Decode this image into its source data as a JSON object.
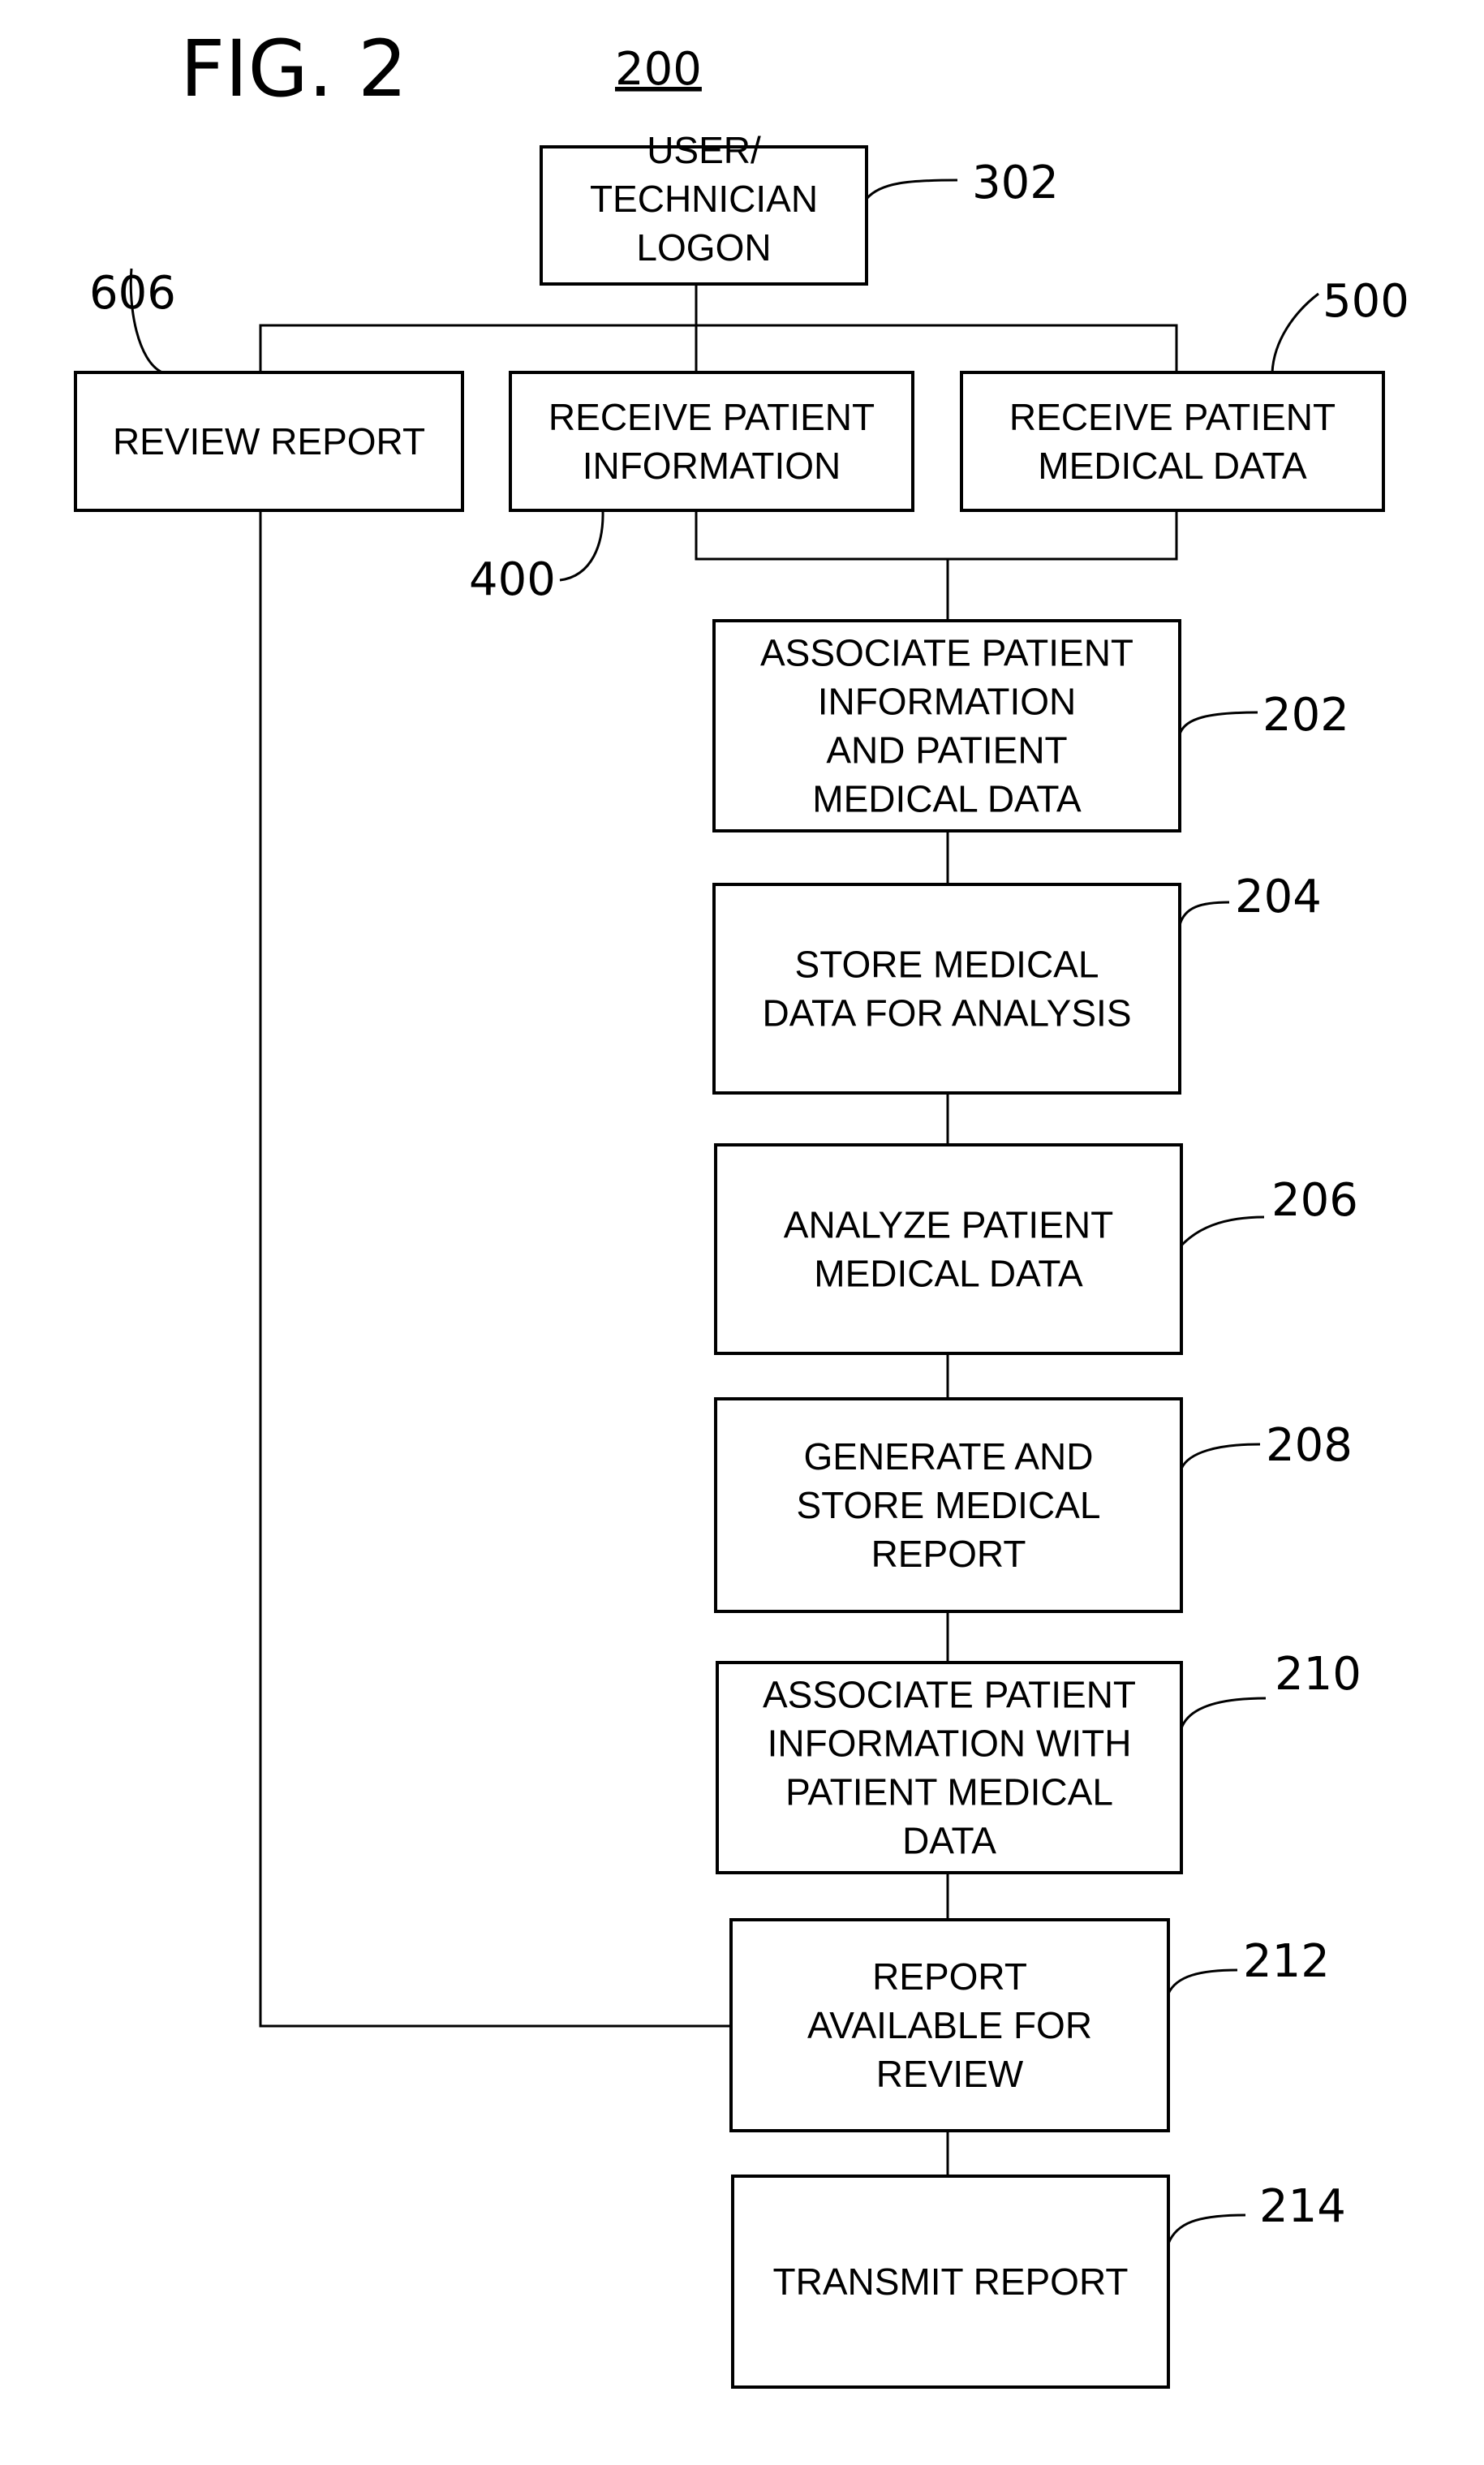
{
  "figure": {
    "title": "FIG. 2",
    "number": "200"
  },
  "nodes": [
    {
      "id": "302",
      "ref": "302",
      "lines": [
        "USER/",
        "TECHNICIAN",
        "LOGON"
      ]
    },
    {
      "id": "606",
      "ref": "606",
      "lines": [
        "REVIEW REPORT"
      ]
    },
    {
      "id": "400",
      "ref": "400",
      "lines": [
        "RECEIVE PATIENT",
        "INFORMATION"
      ]
    },
    {
      "id": "500",
      "ref": "500",
      "lines": [
        "RECEIVE PATIENT",
        "MEDICAL DATA"
      ]
    },
    {
      "id": "202",
      "ref": "202",
      "lines": [
        "ASSOCIATE PATIENT",
        "INFORMATION",
        "AND PATIENT",
        "MEDICAL DATA"
      ]
    },
    {
      "id": "204",
      "ref": "204",
      "lines": [
        "STORE MEDICAL",
        "DATA FOR ANALYSIS"
      ]
    },
    {
      "id": "206",
      "ref": "206",
      "lines": [
        "ANALYZE PATIENT",
        "MEDICAL DATA"
      ]
    },
    {
      "id": "208",
      "ref": "208",
      "lines": [
        "GENERATE AND",
        "STORE MEDICAL",
        "REPORT"
      ]
    },
    {
      "id": "210",
      "ref": "210",
      "lines": [
        "ASSOCIATE PATIENT",
        "INFORMATION WITH",
        "PATIENT MEDICAL",
        "DATA"
      ]
    },
    {
      "id": "212",
      "ref": "212",
      "lines": [
        "REPORT",
        "AVAILABLE FOR",
        "REVIEW"
      ]
    },
    {
      "id": "214",
      "ref": "214",
      "lines": [
        "TRANSMIT REPORT"
      ]
    }
  ],
  "edges": [
    [
      "302",
      "606"
    ],
    [
      "302",
      "400"
    ],
    [
      "302",
      "500"
    ],
    [
      "400",
      "202"
    ],
    [
      "500",
      "202"
    ],
    [
      "202",
      "204"
    ],
    [
      "204",
      "206"
    ],
    [
      "206",
      "208"
    ],
    [
      "208",
      "210"
    ],
    [
      "210",
      "212"
    ],
    [
      "212",
      "214"
    ],
    [
      "606",
      "212"
    ]
  ]
}
